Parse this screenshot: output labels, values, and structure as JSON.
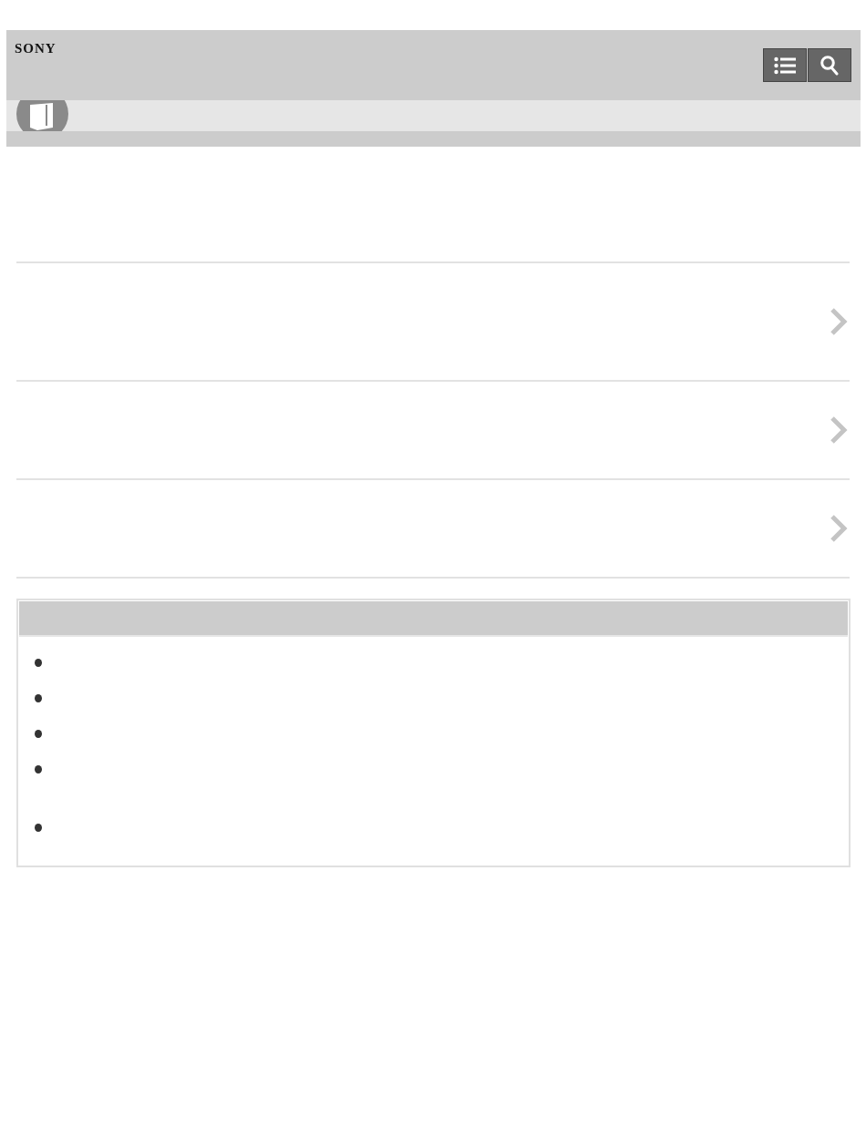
{
  "header": {
    "logo": "SONY",
    "buttons": [
      {
        "kind": "toc"
      },
      {
        "kind": "search"
      }
    ]
  },
  "link_rows": [
    {
      "kind": "tall"
    },
    {
      "kind": "short"
    },
    {
      "kind": "short"
    }
  ],
  "related_box": {
    "bullets": [
      {
        "kind": "line"
      },
      {
        "kind": "line"
      },
      {
        "kind": "line"
      },
      {
        "kind": "double"
      },
      {
        "kind": "line"
      }
    ]
  }
}
